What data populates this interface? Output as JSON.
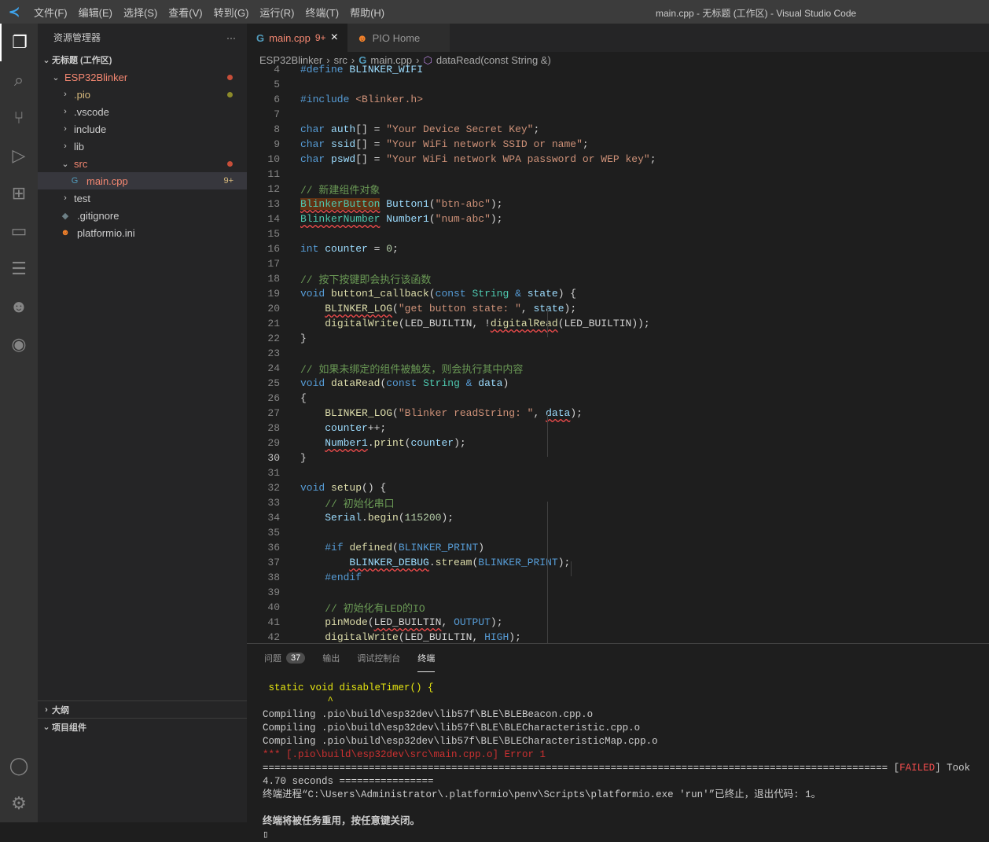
{
  "titlebar": {
    "menus": [
      "文件(F)",
      "编辑(E)",
      "选择(S)",
      "查看(V)",
      "转到(G)",
      "运行(R)",
      "终端(T)",
      "帮助(H)"
    ],
    "title": "main.cpp - 无标题 (工作区) - Visual Studio Code"
  },
  "activity": [
    {
      "name": "explorer-icon",
      "glyph": "❐"
    },
    {
      "name": "search-icon",
      "glyph": "⌕"
    },
    {
      "name": "source-control-icon",
      "glyph": "⑂"
    },
    {
      "name": "run-debug-icon",
      "glyph": "▷"
    },
    {
      "name": "extensions-icon",
      "glyph": "⊞"
    },
    {
      "name": "remote-explorer-icon",
      "glyph": "▭"
    },
    {
      "name": "test-icon",
      "glyph": "☰"
    },
    {
      "name": "platformio-icon",
      "glyph": "☻"
    },
    {
      "name": "espressif-icon",
      "glyph": "◉"
    }
  ],
  "activity_bottom": [
    {
      "name": "account-icon",
      "glyph": "◯"
    },
    {
      "name": "settings-gear-icon",
      "glyph": "⚙"
    }
  ],
  "sidebar": {
    "title": "资源管理器",
    "more": "···",
    "workspace": "无标题 (工作区)",
    "tree": [
      {
        "label": "ESP32Blinker",
        "indent": 1,
        "chev": "⌄",
        "color": "#f48771",
        "dot": "#c74e39"
      },
      {
        "label": ".pio",
        "indent": 2,
        "chev": "›",
        "color": "#d7ba7d",
        "dot": "#8c8a2a"
      },
      {
        "label": ".vscode",
        "indent": 2,
        "chev": "›",
        "color": "#ccc"
      },
      {
        "label": "include",
        "indent": 2,
        "chev": "›",
        "color": "#ccc"
      },
      {
        "label": "lib",
        "indent": 2,
        "chev": "›",
        "color": "#ccc"
      },
      {
        "label": "src",
        "indent": 2,
        "chev": "⌄",
        "color": "#f48771",
        "dot": "#c74e39"
      },
      {
        "label": "main.cpp",
        "indent": 3,
        "icon": "G",
        "color": "#f48771",
        "badge": "9+",
        "sel": true
      },
      {
        "label": "test",
        "indent": 2,
        "chev": "›",
        "color": "#ccc"
      },
      {
        "label": ".gitignore",
        "indent": 2,
        "icon": "◆",
        "color": "#ccc"
      },
      {
        "label": "platformio.ini",
        "indent": 2,
        "icon": "☻",
        "color": "#ccc"
      }
    ],
    "outline": "大纲",
    "project": "项目组件"
  },
  "tabs": [
    {
      "label": "main.cpp",
      "badge": "9+",
      "close": "×"
    },
    {
      "label": "PIO Home"
    }
  ],
  "breadcrumb": [
    "ESP32Blinker",
    "src",
    "main.cpp",
    "dataRead(const String &)"
  ],
  "editor": {
    "current_line": 30,
    "lines": [
      {
        "n": 4,
        "t": [
          [
            "k",
            "#define "
          ],
          [
            "v",
            "BLINKER_WIFI"
          ]
        ]
      },
      {
        "n": 5,
        "t": []
      },
      {
        "n": 6,
        "t": [
          [
            "k",
            "#include "
          ],
          [
            "s",
            "<Blinker.h>"
          ]
        ]
      },
      {
        "n": 7,
        "t": []
      },
      {
        "n": 8,
        "t": [
          [
            "k",
            "char "
          ],
          [
            "v",
            "auth"
          ],
          [
            "",
            "[] = "
          ],
          [
            "s",
            "\"Your Device Secret Key\""
          ],
          [
            "",
            ";"
          ]
        ]
      },
      {
        "n": 9,
        "t": [
          [
            "k",
            "char "
          ],
          [
            "v",
            "ssid"
          ],
          [
            "",
            "[] = "
          ],
          [
            "s",
            "\"Your WiFi network SSID or name\""
          ],
          [
            "",
            ";"
          ]
        ]
      },
      {
        "n": 10,
        "t": [
          [
            "k",
            "char "
          ],
          [
            "v",
            "pswd"
          ],
          [
            "",
            "[] = "
          ],
          [
            "s",
            "\"Your WiFi network WPA password or WEP key\""
          ],
          [
            "",
            ";"
          ]
        ]
      },
      {
        "n": 11,
        "t": []
      },
      {
        "n": 12,
        "t": [
          [
            "c",
            "// 新建组件对象"
          ]
        ]
      },
      {
        "n": 13,
        "t": [
          [
            "t hl sq",
            "BlinkerButton"
          ],
          [
            "",
            " "
          ],
          [
            "v",
            "Button1"
          ],
          [
            "",
            "("
          ],
          [
            "s",
            "\"btn-abc\""
          ],
          [
            "",
            ");"
          ]
        ]
      },
      {
        "n": 14,
        "t": [
          [
            "t sq",
            "BlinkerNumber"
          ],
          [
            "",
            " "
          ],
          [
            "v",
            "Number1"
          ],
          [
            "",
            "("
          ],
          [
            "s",
            "\"num-abc\""
          ],
          [
            "",
            ");"
          ]
        ]
      },
      {
        "n": 15,
        "t": []
      },
      {
        "n": 16,
        "t": [
          [
            "k",
            "int "
          ],
          [
            "v",
            "counter"
          ],
          [
            "",
            " = "
          ],
          [
            "n",
            "0"
          ],
          [
            "",
            ";"
          ]
        ]
      },
      {
        "n": 17,
        "t": []
      },
      {
        "n": 18,
        "t": [
          [
            "c",
            "// 按下按键即会执行该函数"
          ]
        ]
      },
      {
        "n": 19,
        "t": [
          [
            "k",
            "void "
          ],
          [
            "f",
            "button1_callback"
          ],
          [
            "",
            "("
          ],
          [
            "k",
            "const "
          ],
          [
            "t",
            "String"
          ],
          [
            "k",
            " & "
          ],
          [
            "v",
            "state"
          ],
          [
            "",
            ") {"
          ]
        ]
      },
      {
        "n": 20,
        "t": [
          [
            "",
            "    "
          ],
          [
            "f sq",
            "BLINKER_LOG"
          ],
          [
            "",
            "("
          ],
          [
            "s",
            "\"get button state: \""
          ],
          [
            "",
            ", "
          ],
          [
            "v",
            "state"
          ],
          [
            "",
            ");"
          ]
        ]
      },
      {
        "n": 21,
        "t": [
          [
            "",
            "    "
          ],
          [
            "f",
            "digitalWrite"
          ],
          [
            "",
            "("
          ],
          [
            "",
            "LED_BUILTIN, !"
          ],
          [
            "f sq",
            "digitalRead"
          ],
          [
            "",
            "(LED_BUILTIN));"
          ]
        ]
      },
      {
        "n": 22,
        "t": [
          [
            "",
            "}"
          ]
        ]
      },
      {
        "n": 23,
        "t": []
      },
      {
        "n": 24,
        "t": [
          [
            "c",
            "// 如果未绑定的组件被触发，则会执行其中内容"
          ]
        ]
      },
      {
        "n": 25,
        "t": [
          [
            "k",
            "void "
          ],
          [
            "f",
            "dataRead"
          ],
          [
            "",
            "("
          ],
          [
            "k",
            "const "
          ],
          [
            "t",
            "String"
          ],
          [
            "k",
            " & "
          ],
          [
            "v",
            "data"
          ],
          [
            "",
            ")"
          ]
        ]
      },
      {
        "n": 26,
        "t": [
          [
            "",
            "{"
          ]
        ]
      },
      {
        "n": 27,
        "t": [
          [
            "",
            "    "
          ],
          [
            "f",
            "BLINKER_LOG"
          ],
          [
            "",
            "("
          ],
          [
            "s",
            "\"Blinker readString: \""
          ],
          [
            "",
            ", "
          ],
          [
            "v sq",
            "data"
          ],
          [
            "",
            ");"
          ]
        ]
      },
      {
        "n": 28,
        "t": [
          [
            "",
            "    "
          ],
          [
            "v",
            "counter"
          ],
          [
            "",
            "++;"
          ]
        ]
      },
      {
        "n": 29,
        "t": [
          [
            "",
            "    "
          ],
          [
            "v sq",
            "Number1"
          ],
          [
            "",
            "."
          ],
          [
            "f",
            "print"
          ],
          [
            "",
            "("
          ],
          [
            "v",
            "counter"
          ],
          [
            "",
            ");"
          ]
        ]
      },
      {
        "n": 30,
        "t": [
          [
            "",
            "}"
          ]
        ]
      },
      {
        "n": 31,
        "t": []
      },
      {
        "n": 32,
        "t": [
          [
            "k",
            "void "
          ],
          [
            "f",
            "setup"
          ],
          [
            "",
            "() {"
          ]
        ]
      },
      {
        "n": 33,
        "t": [
          [
            "",
            "    "
          ],
          [
            "c",
            "// 初始化串口"
          ]
        ]
      },
      {
        "n": 34,
        "t": [
          [
            "",
            "    "
          ],
          [
            "v",
            "Serial"
          ],
          [
            "",
            "."
          ],
          [
            "f",
            "begin"
          ],
          [
            "",
            "("
          ],
          [
            "n",
            "115200"
          ],
          [
            "",
            ");"
          ]
        ]
      },
      {
        "n": 35,
        "t": []
      },
      {
        "n": 36,
        "t": [
          [
            "",
            "    "
          ],
          [
            "k",
            "#if "
          ],
          [
            "f",
            "defined"
          ],
          [
            "",
            "("
          ],
          [
            "k",
            "BLINKER_PRINT"
          ],
          [
            "",
            ")"
          ]
        ]
      },
      {
        "n": 37,
        "t": [
          [
            "",
            "        "
          ],
          [
            "v sq",
            "BLINKER_DEBUG"
          ],
          [
            "",
            "."
          ],
          [
            "f",
            "stream"
          ],
          [
            "",
            "("
          ],
          [
            "k",
            "BLINKER_PRINT"
          ],
          [
            "",
            ");"
          ]
        ]
      },
      {
        "n": 38,
        "t": [
          [
            "",
            "    "
          ],
          [
            "k",
            "#endif"
          ]
        ]
      },
      {
        "n": 39,
        "t": []
      },
      {
        "n": 40,
        "t": [
          [
            "",
            "    "
          ],
          [
            "c",
            "// 初始化有LED的IO"
          ]
        ]
      },
      {
        "n": 41,
        "t": [
          [
            "",
            "    "
          ],
          [
            "f",
            "pinMode"
          ],
          [
            "",
            "("
          ],
          [
            "sq",
            "LED_BUILTIN"
          ],
          [
            "",
            ", "
          ],
          [
            "k",
            "OUTPUT"
          ],
          [
            "",
            ");"
          ]
        ]
      },
      {
        "n": 42,
        "t": [
          [
            "",
            "    "
          ],
          [
            "f",
            "digitalWrite"
          ],
          [
            "",
            "("
          ],
          [
            "",
            "LED_BUILTIN, "
          ],
          [
            "k",
            "HIGH"
          ],
          [
            "",
            ");"
          ]
        ]
      }
    ]
  },
  "panel": {
    "tabs": [
      {
        "label": "问题",
        "count": "37"
      },
      {
        "label": "输出"
      },
      {
        "label": "调试控制台"
      },
      {
        "label": "终端",
        "active": true
      }
    ],
    "terminal": [
      {
        "text": " static void disableTimer() {",
        "color": "#e5e510"
      },
      {
        "text": "           ^",
        "color": "#e5e510"
      },
      {
        "text": "Compiling .pio\\build\\esp32dev\\lib57f\\BLE\\BLEBeacon.cpp.o",
        "color": "#ccc"
      },
      {
        "text": "Compiling .pio\\build\\esp32dev\\lib57f\\BLE\\BLECharacteristic.cpp.o",
        "color": "#ccc"
      },
      {
        "text": "Compiling .pio\\build\\esp32dev\\lib57f\\BLE\\BLECharacteristicMap.cpp.o",
        "color": "#ccc"
      },
      {
        "text": "*** [.pio\\build\\esp32dev\\src\\main.cpp.o] Error 1",
        "color": "#cd3131"
      },
      {
        "parts": [
          [
            "==========================================================================================================",
            ""
          ],
          [
            " [",
            ""
          ],
          [
            "FAILED",
            "#f14c4c"
          ],
          [
            "] Took 4.70 seconds ================",
            ""
          ]
        ]
      },
      {
        "text": "终端进程“C:\\Users\\Administrator\\.platformio\\penv\\Scripts\\platformio.exe 'run'”已终止，退出代码: 1。",
        "color": "#ccc"
      },
      {
        "text": "",
        "color": "#ccc"
      },
      {
        "text": "终端将被任务重用，按任意键关闭。",
        "color": "#ccc",
        "bold": true
      },
      {
        "text": "▯",
        "color": "#ccc"
      }
    ]
  }
}
